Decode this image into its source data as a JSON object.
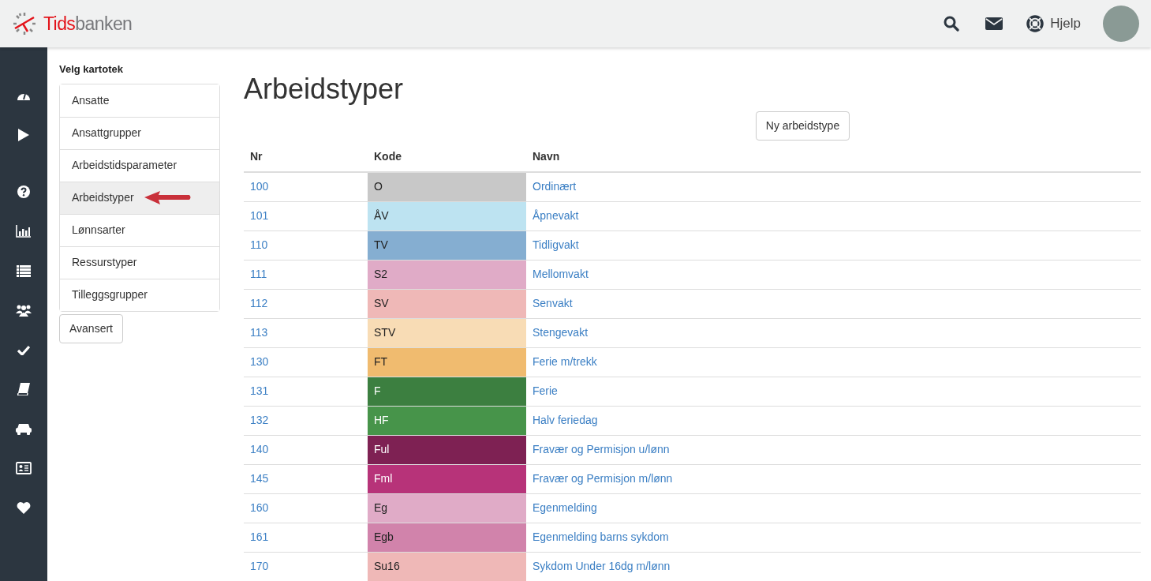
{
  "header": {
    "logo": {
      "part_1": "Tids",
      "part_2": "banken"
    },
    "help_label": "Hjelp"
  },
  "kartotek": {
    "title": "Velg kartotek",
    "items": [
      {
        "label": "Ansatte",
        "selected": false
      },
      {
        "label": "Ansattgrupper",
        "selected": false
      },
      {
        "label": "Arbeidstidsparameter",
        "selected": false
      },
      {
        "label": "Arbeidstyper",
        "selected": true
      },
      {
        "label": "Lønnsarter",
        "selected": false
      },
      {
        "label": "Ressurstyper",
        "selected": false
      },
      {
        "label": "Tilleggsgrupper",
        "selected": false
      }
    ],
    "advanced_button": "Avansert"
  },
  "main": {
    "title": "Arbeidstyper",
    "new_button": "Ny arbeidstype",
    "table": {
      "columns": [
        "Nr",
        "Kode",
        "Navn"
      ],
      "rows": [
        {
          "nr": "100",
          "kode": "O",
          "navn": "Ordinært",
          "color": "#c8c8c8"
        },
        {
          "nr": "101",
          "kode": "ÅV",
          "navn": "Åpnevakt",
          "color": "#bde3f1"
        },
        {
          "nr": "110",
          "kode": "TV",
          "navn": "Tidligvakt",
          "color": "#85aed1"
        },
        {
          "nr": "111",
          "kode": "S2",
          "navn": "Mellomvakt",
          "color": "#e0abc7"
        },
        {
          "nr": "112",
          "kode": "SV",
          "navn": "Senvakt",
          "color": "#efb8b7"
        },
        {
          "nr": "113",
          "kode": "STV",
          "navn": "Stengevakt",
          "color": "#f8dcb5"
        },
        {
          "nr": "130",
          "kode": "FT",
          "navn": "Ferie m/trekk",
          "color": "#f0bb6f"
        },
        {
          "nr": "131",
          "kode": "F",
          "navn": "Ferie",
          "color": "#3c7f40"
        },
        {
          "nr": "132",
          "kode": "HF",
          "navn": "Halv feriedag",
          "color": "#47944a"
        },
        {
          "nr": "140",
          "kode": "Ful",
          "navn": "Fravær og Permisjon u/lønn",
          "color": "#7e2153"
        },
        {
          "nr": "145",
          "kode": "Fml",
          "navn": "Fravær og Permisjon m/lønn",
          "color": "#b73379"
        },
        {
          "nr": "160",
          "kode": "Eg",
          "navn": "Egenmelding",
          "color": "#e0abc7"
        },
        {
          "nr": "161",
          "kode": "Egb",
          "navn": "Egenmelding barns sykdom",
          "color": "#d183ab"
        },
        {
          "nr": "170",
          "kode": "Su16",
          "navn": "Sykdom Under 16dg m/lønn",
          "color": "#efb8b7"
        }
      ]
    }
  }
}
